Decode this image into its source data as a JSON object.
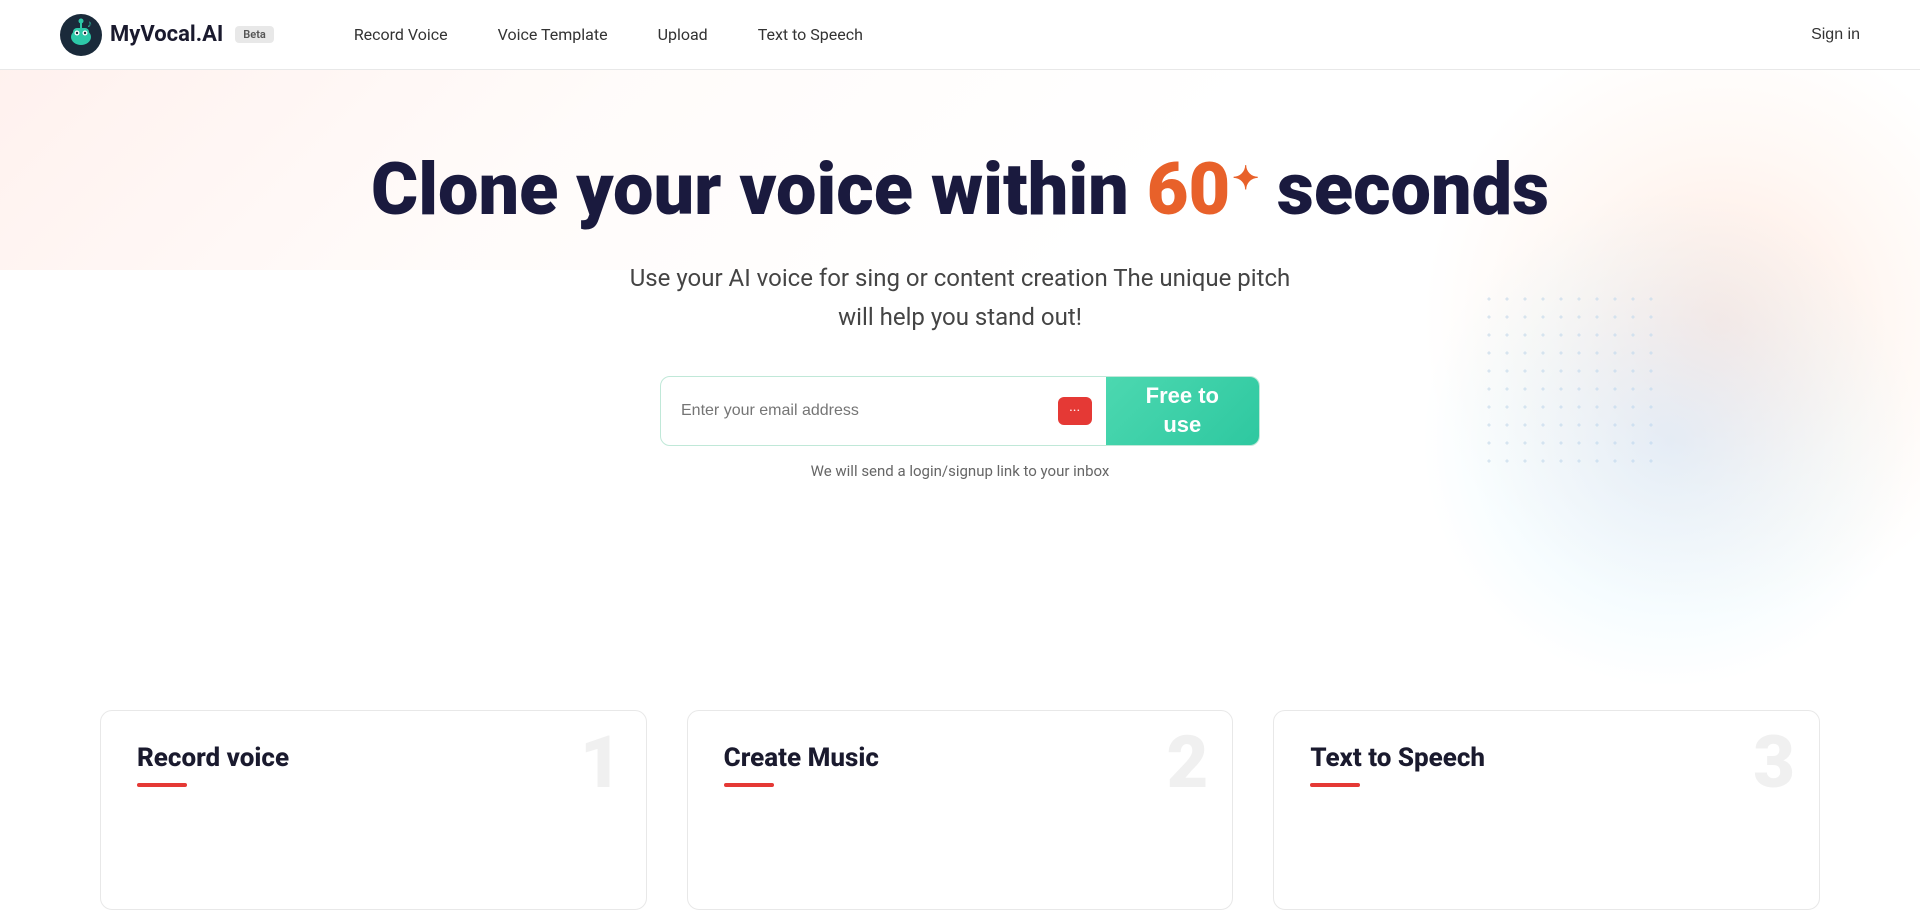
{
  "navbar": {
    "logo_text": "MyVocal.AI",
    "beta_label": "Beta",
    "nav_items": [
      {
        "label": "Record Voice",
        "id": "record-voice"
      },
      {
        "label": "Voice Template",
        "id": "voice-template"
      },
      {
        "label": "Upload",
        "id": "upload"
      },
      {
        "label": "Text to Speech",
        "id": "text-to-speech"
      }
    ],
    "sign_in": "Sign in"
  },
  "hero": {
    "title_start": "Clone your voice within ",
    "title_number": "60",
    "title_sparkle": "✦",
    "title_end": " seconds",
    "subtitle": "Use your AI voice for sing or content creation The unique pitch will help you stand out!",
    "email_placeholder": "Enter your email address",
    "free_btn_line1": "Free to",
    "free_btn_line2": "use",
    "helper_text": "We will send a login/signup link to your inbox"
  },
  "features": [
    {
      "number": "1",
      "title": "Record voice",
      "id": "record-voice-card"
    },
    {
      "number": "2",
      "title": "Create Music",
      "id": "create-music-card"
    },
    {
      "number": "3",
      "title": "Text to Speech",
      "id": "text-to-speech-card"
    }
  ],
  "colors": {
    "accent_orange": "#e8612a",
    "accent_green": "#2ec8a0",
    "accent_red": "#e53935",
    "text_dark": "#1a1a3e"
  }
}
